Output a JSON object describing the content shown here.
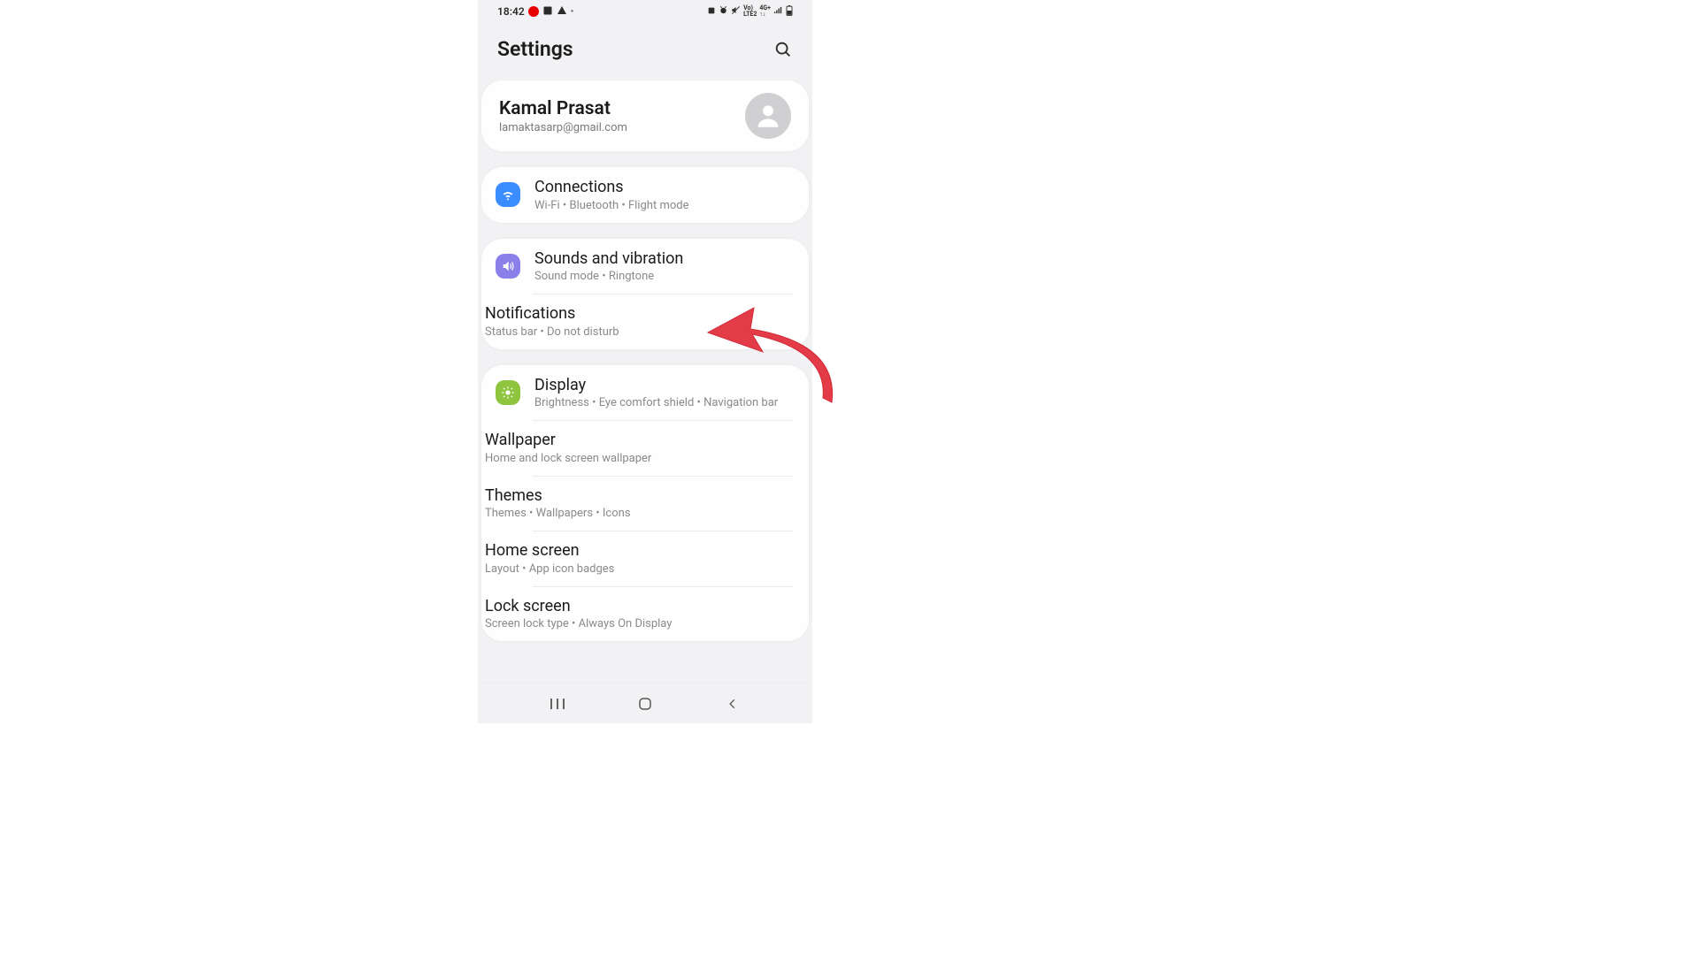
{
  "status": {
    "time": "18:42",
    "right_text": "Vo) 4G+"
  },
  "header": {
    "title": "Settings"
  },
  "account": {
    "name": "Kamal Prasat",
    "email": "lamaktasarp@gmail.com"
  },
  "groups": [
    {
      "rows": [
        {
          "icon_color": "#3b8cff",
          "title": "Connections",
          "sub": "Wi-Fi  •  Bluetooth  •  Flight mode",
          "name": "connections"
        }
      ]
    },
    {
      "rows": [
        {
          "icon_color": "#8b80ea",
          "title": "Sounds and vibration",
          "sub": "Sound mode  •  Ringtone",
          "name": "sounds-vibration"
        },
        {
          "icon_color": "#e77d6c",
          "title": "Notifications",
          "sub": "Status bar  •  Do not disturb",
          "name": "notifications"
        }
      ]
    },
    {
      "rows": [
        {
          "icon_color": "#8fc43f",
          "title": "Display",
          "sub": "Brightness  •  Eye comfort shield  •  Navigation bar",
          "name": "display"
        },
        {
          "icon_color": "#e25d93",
          "title": "Wallpaper",
          "sub": "Home and lock screen wallpaper",
          "name": "wallpaper"
        },
        {
          "icon_color": "#a278e6",
          "title": "Themes",
          "sub": "Themes  •  Wallpapers  •  Icons",
          "name": "themes"
        },
        {
          "icon_color": "#1db4c9",
          "title": "Home screen",
          "sub": "Layout  •  App icon badges",
          "name": "home-screen"
        },
        {
          "icon_color": "#179c7a",
          "title": "Lock screen",
          "sub": "Screen lock type  •  Always On Display",
          "name": "lock-screen"
        }
      ]
    }
  ],
  "icons": {
    "connections": "wifi",
    "sounds-vibration": "volume",
    "notifications": "toggle",
    "display": "sun",
    "wallpaper": "image",
    "themes": "palette",
    "home-screen": "home",
    "lock-screen": "lock"
  }
}
